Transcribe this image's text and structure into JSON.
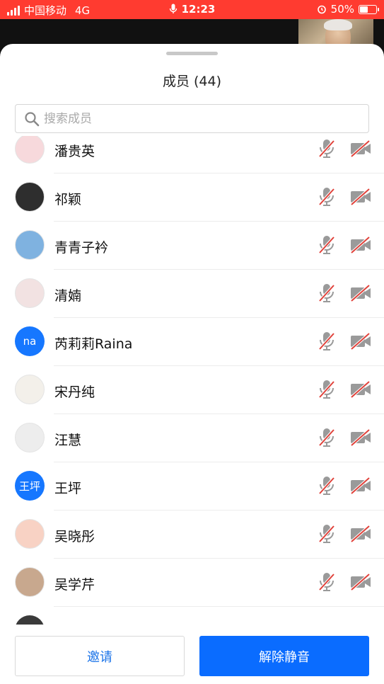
{
  "status_bar": {
    "carrier": "中国移动",
    "network": "4G",
    "time": "12:23",
    "battery": "50%",
    "battery_level": 0.5
  },
  "sheet": {
    "title": "成员 (44)",
    "search_placeholder": "搜索成员"
  },
  "members": [
    {
      "name": "潘贵英",
      "avatar_text": "",
      "avatar_color": "#f7d9dc",
      "mic_muted": true,
      "video_off": true
    },
    {
      "name": "祁颖",
      "avatar_text": "",
      "avatar_color": "#2e2e2e",
      "mic_muted": true,
      "video_off": true
    },
    {
      "name": "青青子衿",
      "avatar_text": "",
      "avatar_color": "#7fb2e0",
      "mic_muted": true,
      "video_off": true
    },
    {
      "name": "清婻",
      "avatar_text": "",
      "avatar_color": "#f2e2e2",
      "mic_muted": true,
      "video_off": true
    },
    {
      "name": "芮莉莉Raina",
      "avatar_text": "na",
      "avatar_color": "#1677ff",
      "mic_muted": true,
      "video_off": true
    },
    {
      "name": "宋丹纯",
      "avatar_text": "",
      "avatar_color": "#f3f0ea",
      "mic_muted": true,
      "video_off": true
    },
    {
      "name": "汪慧",
      "avatar_text": "",
      "avatar_color": "#ededed",
      "mic_muted": true,
      "video_off": true
    },
    {
      "name": "王坪",
      "avatar_text": "王坪",
      "avatar_color": "#1677ff",
      "mic_muted": true,
      "video_off": true
    },
    {
      "name": "吴晓彤",
      "avatar_text": "",
      "avatar_color": "#f8d2c4",
      "mic_muted": true,
      "video_off": true
    },
    {
      "name": "吴学芹",
      "avatar_text": "",
      "avatar_color": "#c8a88e",
      "mic_muted": true,
      "video_off": true
    }
  ],
  "footer": {
    "invite_label": "邀请",
    "unmute_label": "解除静音"
  },
  "colors": {
    "status_bar": "#ff3b30",
    "accent": "#0a6cff",
    "muted_red": "#e0413a",
    "icon_gray": "#9a9a9a"
  }
}
